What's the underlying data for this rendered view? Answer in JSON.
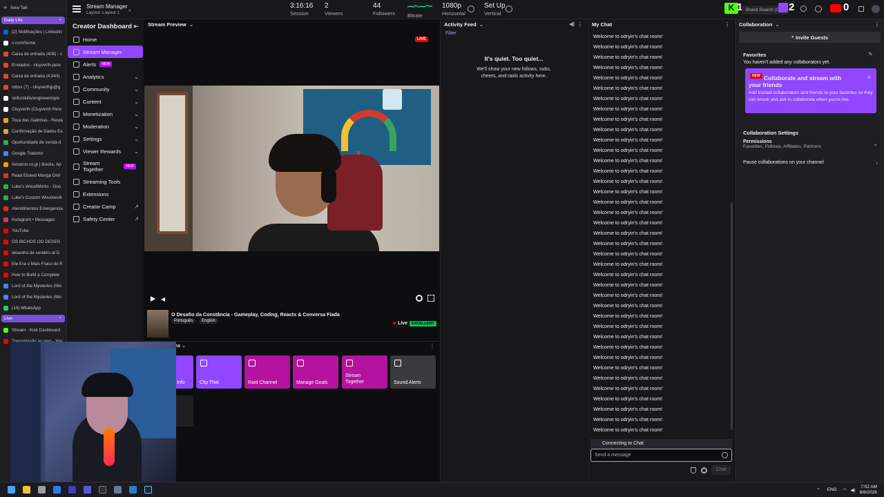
{
  "tabs": {
    "new_tab": "New Tab",
    "group_daily": "Daily Life",
    "items": [
      {
        "label": "(2) Notificações | LinkedIn",
        "color": "#0a66c2"
      },
      {
        "label": "x.com/home",
        "color": "#ffffff"
      },
      {
        "label": "Caixa de entrada (408) - c",
        "color": "#ea4335"
      },
      {
        "label": "Enviados - cluyverth.pere",
        "color": "#ea4335"
      },
      {
        "label": "Caixa de entrada (4.943)",
        "color": "#ea4335"
      },
      {
        "label": "Inbox (7) - cluyverthjp@g",
        "color": "#ea4335"
      },
      {
        "label": "skills/skills/engineering/e",
        "color": "#ffffff"
      },
      {
        "label": "Cluyverth (Cluyverth Pere",
        "color": "#ffffff"
      },
      {
        "label": "Toca das Galinhas - Resta",
        "color": "#e8a33b"
      },
      {
        "label": "Confirmação de Dados Es",
        "color": "#e8a33b"
      },
      {
        "label": "Oportunidade de venda d",
        "color": "#34a853"
      },
      {
        "label": "Google Tradutor",
        "color": "#4285f4"
      },
      {
        "label": "Amazon.co.jp | Books, Ap",
        "color": "#ff9900"
      },
      {
        "label": "Read Elceed Manga Onli",
        "color": "#d93025"
      },
      {
        "label": "Luke's WoodWorks - Goo",
        "color": "#34a853"
      },
      {
        "label": "Luke's Custom Woodwork",
        "color": "#34a853"
      },
      {
        "label": "Atendimentos Emergencia",
        "color": "#d93025"
      },
      {
        "label": "Instagram • Messages",
        "color": "#e1306c"
      },
      {
        "label": "YouTube",
        "color": "#ff0000"
      },
      {
        "label": "OS BICHOS OO DESEN",
        "color": "#ff0000"
      },
      {
        "label": "desenho de cerebro at D",
        "color": "#ff0000"
      },
      {
        "label": "Ele Era o Mais Fraco do R",
        "color": "#ff0000"
      },
      {
        "label": "How to Build a Complete",
        "color": "#ff0000"
      },
      {
        "label": "Lord of the Mysteries (Wo",
        "color": "#4285f4"
      },
      {
        "label": "Lord of the Mysteries (Wo",
        "color": "#4285f4"
      },
      {
        "label": "(14) WhatsApp",
        "color": "#25d366"
      }
    ],
    "group_live": "Live",
    "live_items": [
      {
        "label": "Stream - Kick Dashboard",
        "color": "#53fc18"
      },
      {
        "label": "Transmissão ao vivo - You",
        "color": "#ff0000"
      }
    ]
  },
  "topbar": {
    "title": "Stream Manager",
    "layout": "Layout: Layout 1",
    "session_value": "3:16:16",
    "session_label": "Session",
    "viewers_value": "2",
    "viewers_label": "Viewers",
    "followers_value": "44",
    "followers_label": "Followers",
    "bitrate_label": "Bitrate",
    "horizontal_value": "1080p",
    "horizontal_label": "Horizontal",
    "vertical_value": "Set Up",
    "vertical_label": "Vertical",
    "search_placeholder": "Board Search (Ctrl",
    "badge_kick": "1",
    "badge_twitch": "2",
    "badge_youtube": "0"
  },
  "nav": {
    "title": "Creator Dashboard",
    "items": [
      {
        "label": "Home",
        "chev": ""
      },
      {
        "label": "Stream Manager",
        "chev": "",
        "active": true
      },
      {
        "label": "Alerts",
        "chev": "",
        "badge": "NEW"
      },
      {
        "label": "Analytics",
        "chev": "⌄"
      },
      {
        "label": "Community",
        "chev": "⌄"
      },
      {
        "label": "Content",
        "chev": "⌄"
      },
      {
        "label": "Monetization",
        "chev": "⌄"
      },
      {
        "label": "Moderation",
        "chev": "⌄"
      },
      {
        "label": "Settings",
        "chev": "⌄"
      },
      {
        "label": "Viewer Rewards",
        "chev": "⌄"
      },
      {
        "label": "Stream Together",
        "chev": "",
        "badge": "NEW"
      },
      {
        "label": "Streaming Tools",
        "chev": ""
      },
      {
        "label": "Extensions",
        "chev": ""
      },
      {
        "label": "Creator Camp",
        "chev": "↗"
      },
      {
        "label": "Safety Center",
        "chev": "↗"
      }
    ]
  },
  "preview": {
    "header": "Stream Preview",
    "live_badge": "LIVE",
    "stream_title": "O Desafio da Constância - Gameplay, Coding, Reacts & Conversa Fiada",
    "tag1": "Português",
    "tag2": "English",
    "live_status": "Live",
    "health": "EXCELLENT",
    "actions_header": "ns",
    "actions": [
      {
        "label": "Info",
        "color": "#9147ff"
      },
      {
        "label": "Clip That",
        "color": "#9147ff"
      },
      {
        "label": "Raid Channel",
        "color": "#b3139e"
      },
      {
        "label": "Manage Goals",
        "color": "#b3139e"
      },
      {
        "label": "Stream Together",
        "color": "#b3139e"
      },
      {
        "label": "Sound Alerts",
        "color": "#3a3a3d"
      }
    ]
  },
  "activity": {
    "header": "Activity Feed",
    "filter": "Filter",
    "empty_title": "It's quiet. Too quiet...",
    "empty_body": "We'll show your new follows, subs, cheers, and raids activity here."
  },
  "chat": {
    "header": "My Chat",
    "message": "Welcome to odryin's chat room!",
    "count": 39,
    "connecting": "Connecting to Chat",
    "input_placeholder": "Send a message",
    "send": "Chat"
  },
  "collab": {
    "header": "Collaboration",
    "invite": "Invite Guests",
    "favorites_title": "Favorites",
    "favorites_empty": "You haven't added any collaborators yet.",
    "promo_badge": "NEW",
    "promo_title": "Collaborate and stream with your friends",
    "promo_body": "Add trusted collaborators and friends to your favorites so they can knock and ask to collaborate when you're live.",
    "settings_title": "Collaboration Settings",
    "permissions_title": "Permissions",
    "permissions_sub": "Favorites, Follows, Affiliates, Partners",
    "pause": "Pause collaborations on your channel"
  },
  "taskbar": {
    "lang": "ENG",
    "time": "7:02 AM",
    "date": "8/8/2026"
  }
}
